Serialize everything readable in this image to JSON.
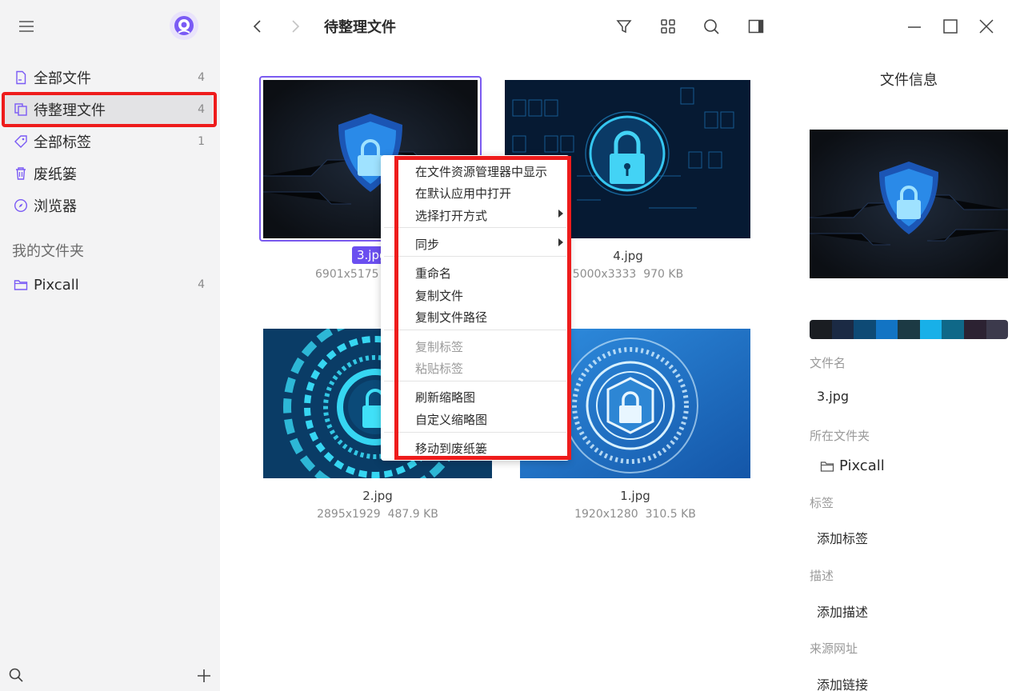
{
  "sidebar": {
    "items": [
      {
        "label": "全部文件",
        "count": "4",
        "icon": "file-icon"
      },
      {
        "label": "待整理文件",
        "count": "4",
        "icon": "copy-icon"
      },
      {
        "label": "全部标签",
        "count": "1",
        "icon": "tag-icon"
      },
      {
        "label": "废纸篓",
        "count": "",
        "icon": "trash-icon"
      },
      {
        "label": "浏览器",
        "count": "",
        "icon": "compass-icon"
      }
    ],
    "section_title": "我的文件夹",
    "folders": [
      {
        "label": "Pixcall",
        "count": "4",
        "icon": "folder-icon"
      }
    ]
  },
  "toolbar": {
    "title": "待整理文件"
  },
  "files": [
    {
      "name": "3.jpg",
      "dims": "6901x5175",
      "size": "",
      "selected": true
    },
    {
      "name": "4.jpg",
      "dims": "5000x3333",
      "size": "970 KB"
    },
    {
      "name": "2.jpg",
      "dims": "2895x1929",
      "size": "487.9 KB"
    },
    {
      "name": "1.jpg",
      "dims": "1920x1280",
      "size": "310.5 KB"
    }
  ],
  "context_menu": {
    "groups": [
      [
        {
          "label": "在文件资源管理器中显示"
        },
        {
          "label": "在默认应用中打开"
        },
        {
          "label": "选择打开方式",
          "submenu": true
        }
      ],
      [
        {
          "label": "同步",
          "submenu": true
        }
      ],
      [
        {
          "label": "重命名"
        },
        {
          "label": "复制文件"
        },
        {
          "label": "复制文件路径"
        }
      ],
      [
        {
          "label": "复制标签",
          "disabled": true
        },
        {
          "label": "粘贴标签",
          "disabled": true
        }
      ],
      [
        {
          "label": "刷新缩略图"
        },
        {
          "label": "自定义缩略图"
        }
      ],
      [
        {
          "label": "移动到废纸篓"
        }
      ]
    ]
  },
  "info_panel": {
    "title": "文件信息",
    "palette": [
      "#1a1d22",
      "#1b2a44",
      "#0e4a75",
      "#1274c4",
      "#1c3a44",
      "#18b0e8",
      "#0f6888",
      "#2c2232",
      "#3c3a4c"
    ],
    "filename_label": "文件名",
    "filename_value": "3.jpg",
    "folder_label": "所在文件夹",
    "folder_value": "Pixcall",
    "tags_label": "标签",
    "tags_value": "添加标签",
    "desc_label": "描述",
    "desc_value": "添加描述",
    "source_label": "来源网址",
    "source_value": "添加链接"
  },
  "colors": {
    "accent": "#6b4ff0",
    "highlight": "#ee1c1c"
  }
}
